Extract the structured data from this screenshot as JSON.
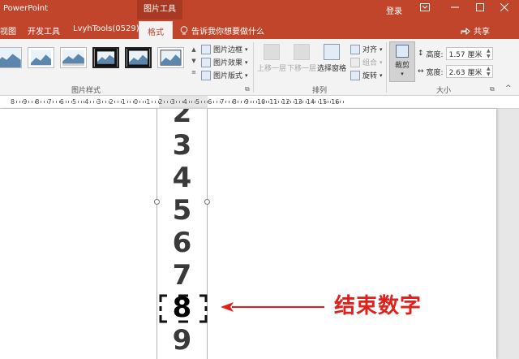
{
  "window": {
    "app_title": "PowerPoint",
    "context_tab": "图片工具",
    "login": "登录",
    "min_icon": "minimize-icon",
    "max_icon": "maximize-icon",
    "close_icon": "close-icon",
    "ribbon_display_icon": "ribbon-display-icon"
  },
  "tabs": {
    "items": [
      {
        "label": "视图"
      },
      {
        "label": "开发工具"
      },
      {
        "label": "LvyhTools(0529)"
      },
      {
        "label": "格式",
        "active": true
      }
    ],
    "tell_me": "告诉我你想要做什么",
    "share": "共享"
  },
  "ribbon": {
    "picture_styles_label": "图片样式",
    "style_thumbs": [
      "style-thumb-1",
      "style-thumb-2",
      "style-thumb-3",
      "style-thumb-4",
      "style-thumb-5",
      "style-thumb-6"
    ],
    "picture_border": "图片边框",
    "picture_effects": "图片效果",
    "picture_layout": "图片版式",
    "bring_forward": "上移一层",
    "send_backward": "下移一层",
    "selection_pane": "选择窗格",
    "align": "对齐",
    "group": "组合",
    "rotate": "旋转",
    "arrange_label": "排列",
    "crop": "裁剪",
    "height_label": "高度:",
    "height_value": "1.57 厘米",
    "width_label": "宽度:",
    "width_value": "2.63 厘米",
    "size_label": "大小"
  },
  "ruler": {
    "labels": [
      "8",
      "9",
      "8",
      "7",
      "6",
      "5",
      "4",
      "3",
      "2",
      "1",
      "0",
      "1",
      "2",
      "3",
      "4",
      "5",
      "6",
      "7",
      "8",
      "9",
      "10",
      "11",
      "12",
      "13",
      "14",
      "15",
      "16"
    ]
  },
  "slide": {
    "digits": [
      "2",
      "3",
      "4",
      "5",
      "6",
      "7",
      "8",
      "9"
    ],
    "highlighted_digit": "8",
    "annotation": "结束数字",
    "annotation_color": "#e0201a"
  },
  "colors": {
    "accent": "#c1452b",
    "ribbon_bg": "#f3f3f3"
  }
}
